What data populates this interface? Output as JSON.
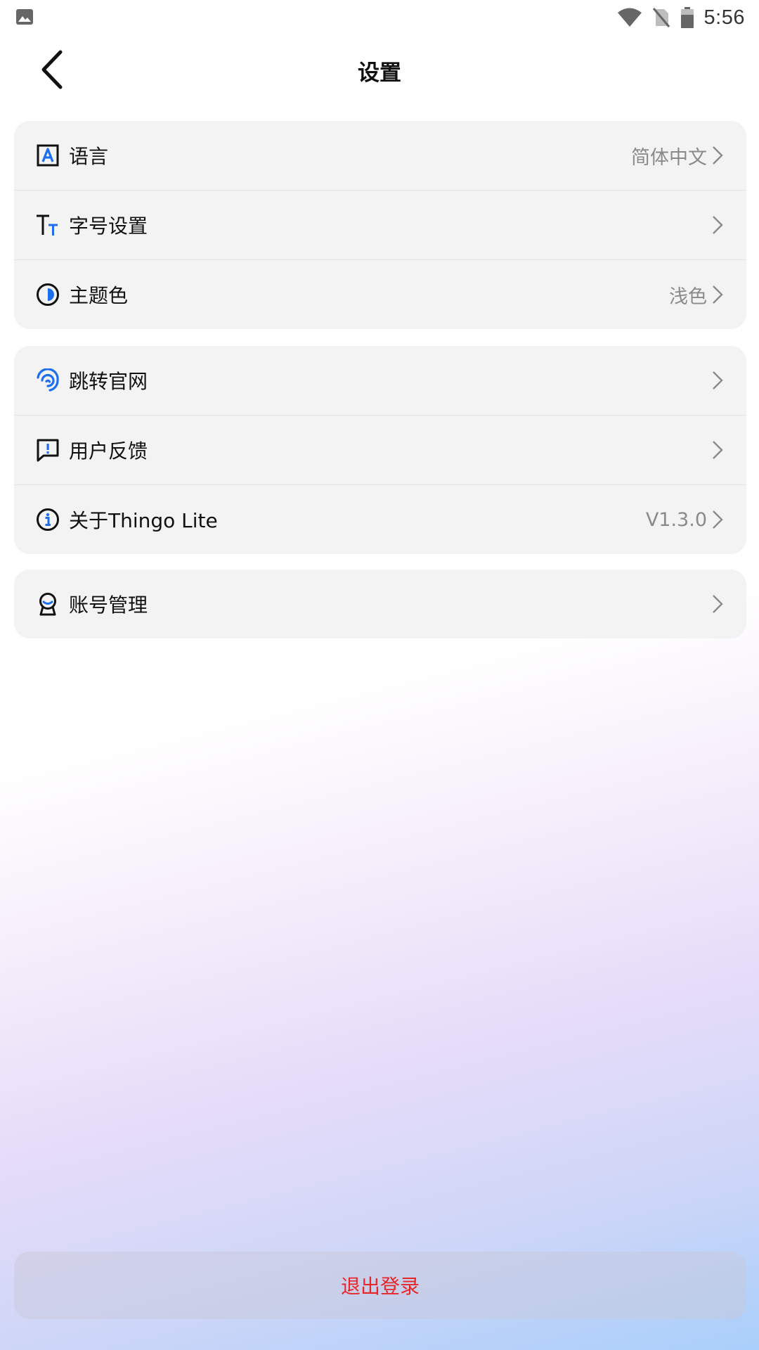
{
  "status_bar": {
    "time": "5:56",
    "left_icon": "image-icon",
    "right_icons": [
      "wifi-icon",
      "no-sim-icon",
      "battery-icon"
    ]
  },
  "header": {
    "title": "设置",
    "back_icon": "back-arrow-icon"
  },
  "groups": [
    {
      "items": [
        {
          "label": "语言",
          "value": "简体中文",
          "icon": "language-icon"
        },
        {
          "label": "字号设置",
          "value": "",
          "icon": "font-size-icon"
        },
        {
          "label": "主题色",
          "value": "浅色",
          "icon": "theme-icon"
        }
      ]
    },
    {
      "items": [
        {
          "label": "跳转官网",
          "value": "",
          "icon": "website-icon"
        },
        {
          "label": "用户反馈",
          "value": "",
          "icon": "feedback-icon"
        },
        {
          "label": "关于Thingo Lite",
          "value": "V1.3.0",
          "icon": "info-icon"
        }
      ]
    },
    {
      "items": [
        {
          "label": "账号管理",
          "value": "",
          "icon": "account-icon"
        }
      ]
    }
  ],
  "logout": {
    "label": "退出登录"
  },
  "colors": {
    "accent_blue": "#1e6ff0",
    "logout_red": "#e8262a",
    "card_bg": "#f3f3f3",
    "secondary_text": "#8a8a8a"
  }
}
